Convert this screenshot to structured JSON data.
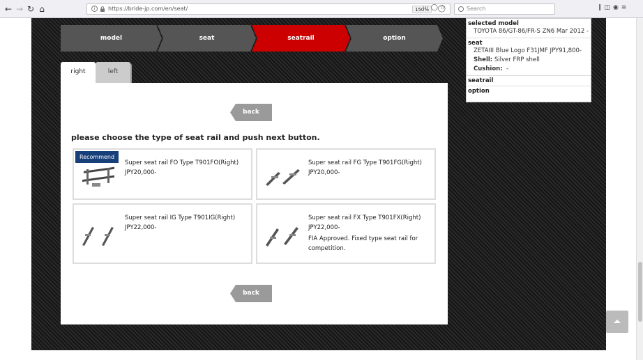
{
  "browser": {
    "url": "https://bride-jp.com/en/seat/",
    "zoom": "150%",
    "search_placeholder": "Search"
  },
  "steps": [
    {
      "label": "model"
    },
    {
      "label": "seat"
    },
    {
      "label": "seatrail"
    },
    {
      "label": "option"
    }
  ],
  "accent_color": "#cc0000",
  "tabs": {
    "right": "right",
    "left": "left"
  },
  "panel": {
    "back_label": "back",
    "instruction": "please choose the type of seat rail and push next button.",
    "products": [
      {
        "badge": "Recommend",
        "name": "Super seat rail FO Type T901FO(Right)",
        "price": "JPY20,000-",
        "note": ""
      },
      {
        "badge": "",
        "name": "Super seat rail FG Type T901FG(Right)",
        "price": "JPY20,000-",
        "note": ""
      },
      {
        "badge": "",
        "name": "Super seat rail IG Type T901IG(Right)",
        "price": "JPY22,000-",
        "note": ""
      },
      {
        "badge": "",
        "name": "Super seat rail FX Type T901FX(Right)",
        "price": "JPY22,000-",
        "note": "FIA Approved. Fixed type seat rail for competition."
      }
    ]
  },
  "sidebar": {
    "model_head": "selected model",
    "model_value": "TOYOTA 86/GT-86/FR-S ZN6 Mar 2012 -",
    "seat_head": "seat",
    "seat_value": "ZETAIII Blue Logo F31JMF JPY91,800-",
    "shell_label": "Shell:",
    "shell_value": "Silver FRP shell",
    "cushion_label": "Cushion:",
    "cushion_value": "-",
    "seatrail_head": "seatrail",
    "option_head": "option"
  }
}
